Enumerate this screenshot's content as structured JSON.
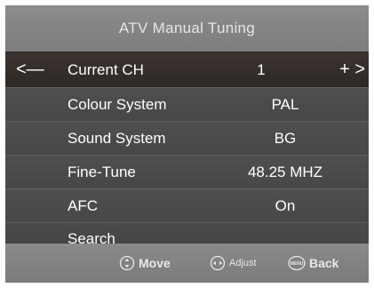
{
  "title": "ATV Manual Tuning",
  "menu": {
    "current_ch": {
      "label": "Current CH",
      "value": "1",
      "left_arrow": "<—",
      "right_arrow": "+ >"
    },
    "colour_system": {
      "label": "Colour System",
      "value": "PAL"
    },
    "sound_system": {
      "label": "Sound System",
      "value": "BG"
    },
    "fine_tune": {
      "label": "Fine-Tune",
      "value": "48.25 MHZ"
    },
    "afc": {
      "label": "AFC",
      "value": "On"
    },
    "search": {
      "label": "Search"
    }
  },
  "footer": {
    "move_label": "Move",
    "adjust_label": "Adjust",
    "back_label": "Back",
    "back_icon_text": "MENU"
  },
  "icons": {
    "move": "up-down-circle-icon",
    "adjust": "left-right-circle-icon",
    "back": "menu-button-icon"
  },
  "colors": {
    "title_bar": "#8c8c8c",
    "menu_bg": "#4a4a4a",
    "selected_row": "#332c29",
    "text": "#ffffff"
  }
}
